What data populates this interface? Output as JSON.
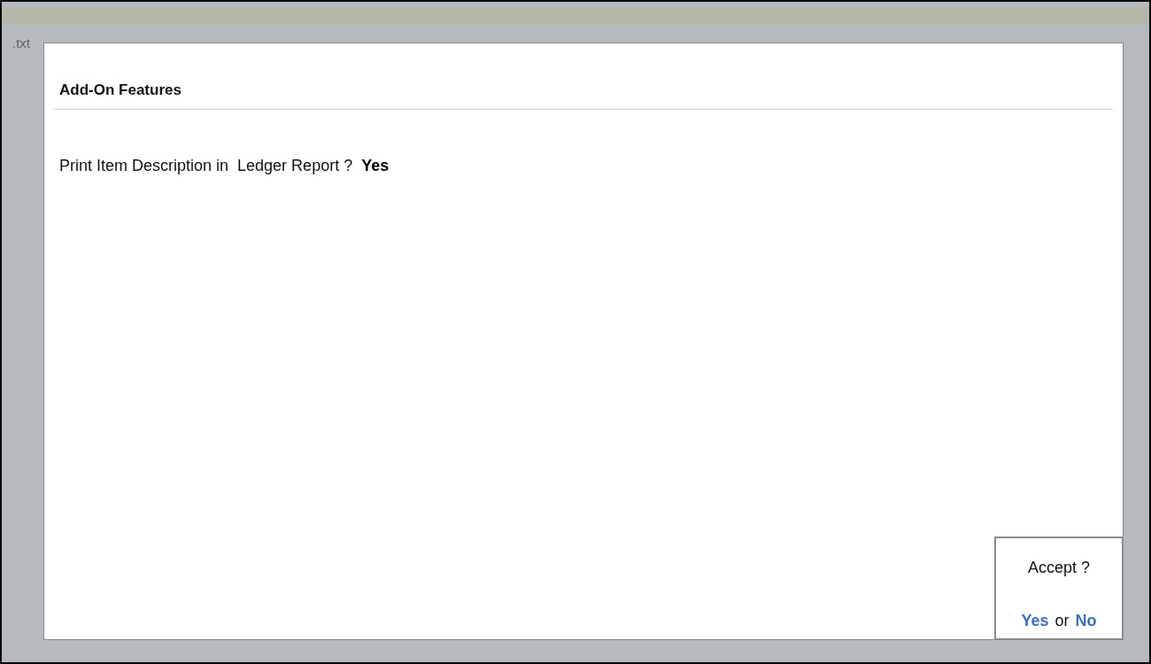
{
  "background_label": ".txt",
  "dialog": {
    "title": "Add-On Features",
    "fields": [
      {
        "label": "Print Item Description in  Ledger Report ?",
        "value": "Yes"
      }
    ]
  },
  "accept": {
    "question": "Accept ?",
    "yes": "Yes",
    "separator": "or",
    "no": "No"
  }
}
